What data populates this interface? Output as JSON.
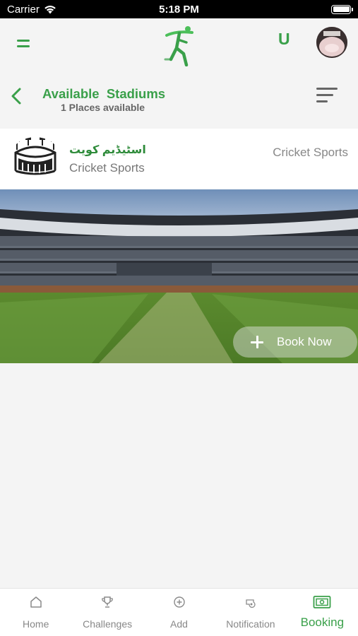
{
  "status_bar": {
    "carrier": "Carrier",
    "time": "5:18 PM"
  },
  "header": {
    "user_initial": "U",
    "accent_color": "#3aa04a"
  },
  "title_bar": {
    "title": "Available  Stadiums",
    "subtitle": "1 Places available"
  },
  "stadium": {
    "name": "اسٹیڈیم کویت",
    "sub_label": "Cricket Sports",
    "category": "Cricket Sports",
    "book_label": "Book Now"
  },
  "bottom_nav": {
    "items": [
      {
        "label": "Home",
        "icon": "home-icon"
      },
      {
        "label": "Challenges",
        "icon": "trophy-icon"
      },
      {
        "label": "Add",
        "icon": "add-circle-icon"
      },
      {
        "label": "Notification",
        "icon": "whistle-icon"
      },
      {
        "label": "Booking",
        "icon": "ticket-icon",
        "active": true
      }
    ]
  }
}
